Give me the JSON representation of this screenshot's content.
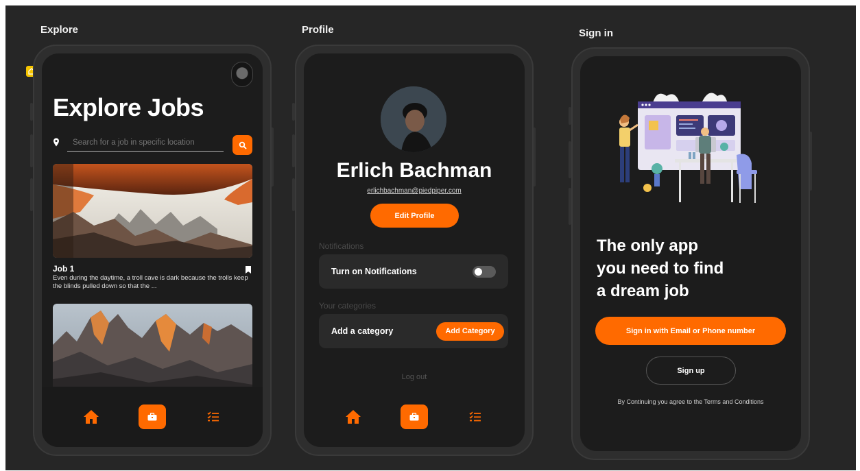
{
  "frames": {
    "explore": "Explore",
    "profile": "Profile",
    "signin": "Sign in"
  },
  "explore": {
    "title": "Explore Jobs",
    "search_placeholder": "Search for a job in specific location",
    "jobs": [
      {
        "title": "Job 1",
        "description": "Even during the daytime, a troll cave is dark because the trolls keep the blinds pulled down so that the ..."
      }
    ]
  },
  "profile": {
    "name": "Erlich Bachman",
    "email": "erlichbachman@piedpiper.com",
    "edit_label": "Edit Profile",
    "notifications_heading": "Notifications",
    "notifications_toggle_label": "Turn on Notifications",
    "notifications_on": false,
    "categories_heading": "Your categories",
    "add_category_text": "Add a category",
    "add_category_button": "Add Category",
    "logout": "Log out"
  },
  "signin": {
    "headline_1": "The only app",
    "headline_2": "you need to find",
    "headline_3": "a dream job",
    "primary_button": "Sign in with Email or Phone number",
    "secondary_button": "Sign up",
    "terms": "By Continuing you agree to the Terms and Conditions"
  },
  "icons": {
    "home": "home-icon",
    "briefcase": "briefcase-icon",
    "checklist": "checklist-icon",
    "search": "search-icon",
    "location": "location-pin-icon",
    "bookmark": "bookmark-icon"
  },
  "colors": {
    "accent": "#ff6a00",
    "background": "#262626",
    "screen": "#1c1c1c",
    "card": "#2a2a2a"
  }
}
